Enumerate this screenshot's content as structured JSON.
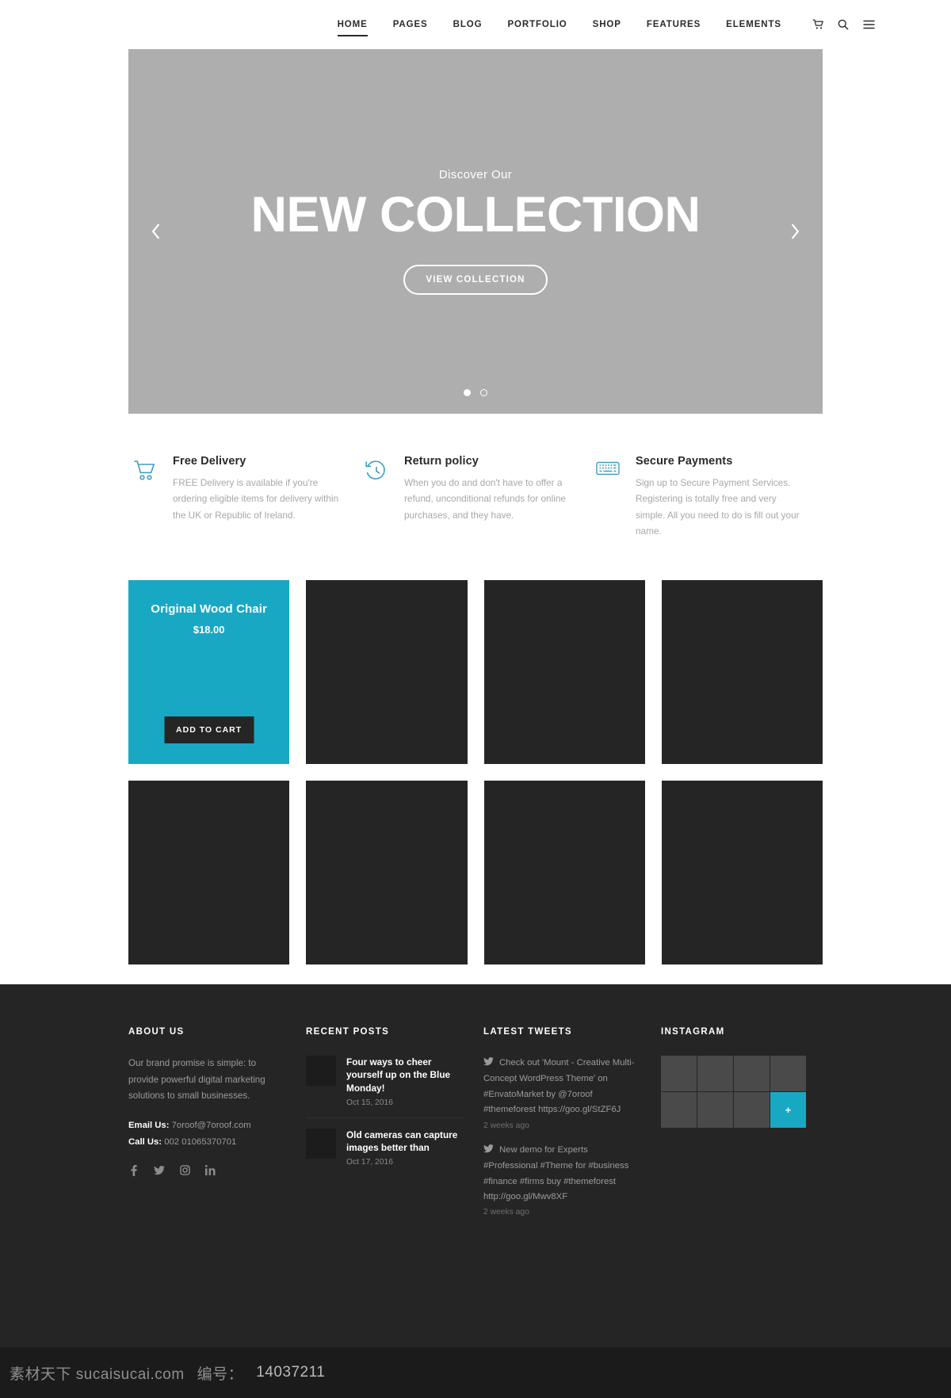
{
  "header": {
    "nav": [
      {
        "label": "HOME",
        "active": true
      },
      {
        "label": "PAGES",
        "active": false
      },
      {
        "label": "BLOG",
        "active": false
      },
      {
        "label": "PORTFOLIO",
        "active": false
      },
      {
        "label": "SHOP",
        "active": false
      },
      {
        "label": "FEATURES",
        "active": false
      },
      {
        "label": "ELEMENTS",
        "active": false
      }
    ],
    "icons": [
      {
        "name": "cart-icon"
      },
      {
        "name": "search-icon"
      },
      {
        "name": "hamburger-menu-icon"
      }
    ]
  },
  "hero": {
    "eyebrow": "Discover Our",
    "title": "NEW COLLECTION",
    "button_label": "VIEW COLLECTION",
    "prev_label": "‹",
    "next_label": "›",
    "slides": 2,
    "active_slide": 1,
    "background_color": "#aeaeae"
  },
  "features": [
    {
      "icon": "shopping-cart-icon",
      "title": "Free Delivery",
      "text": "FREE Delivery is available if you're ordering eligible items for delivery within the UK or Republic of Ireland."
    },
    {
      "icon": "return-clock-icon",
      "title": "Return policy",
      "text": "When you do and don't have to offer a refund, unconditional refunds for online purchases, and they have."
    },
    {
      "icon": "keyboard-icon",
      "title": "Secure Payments",
      "text": "Sign up to Secure Payment Services. Registering is totally free and very simple. All you need to do is fill out your name."
    }
  ],
  "products": {
    "featured": {
      "name": "Original Wood Chair",
      "price": "$18.00",
      "cart_label": "ADD TO CART",
      "accent_color": "#18a8c4"
    },
    "placeholder_count": 7,
    "placeholder_color": "#252525"
  },
  "footer": {
    "about": {
      "title": "ABOUT US",
      "text": "Our brand promise is simple: to provide powerful digital marketing solutions to small businesses.",
      "email_label": "Email Us:",
      "email_value": "7oroof@7oroof.com",
      "call_label": "Call Us:",
      "call_value": "002 01065370701",
      "social": [
        {
          "name": "facebook-icon",
          "glyph": "f"
        },
        {
          "name": "twitter-icon",
          "glyph": "t"
        },
        {
          "name": "instagram-icon",
          "glyph": "i"
        },
        {
          "name": "linkedin-icon",
          "glyph": "in"
        }
      ]
    },
    "recent_posts": {
      "title": "RECENT POSTS",
      "items": [
        {
          "title": "Four ways to cheer yourself up on the Blue Monday!",
          "date": "Oct 15, 2016"
        },
        {
          "title": "Old cameras can capture images better than",
          "date": "Oct 17, 2016"
        }
      ]
    },
    "latest_tweets": {
      "title": "LATEST TWEETS",
      "items": [
        {
          "text": "Check out 'Mount - Creative Multi-Concept WordPress Theme' on #EnvatoMarket by @7oroof #themeforest https://goo.gl/StZF6J",
          "time": "2 weeks ago"
        },
        {
          "text": "New demo for Experts #Professional #Theme for #business #finance #firms buy #themeforest http://goo.gl/Mwv8XF",
          "time": "2 weeks ago"
        }
      ]
    },
    "instagram": {
      "title": "INSTAGRAM",
      "tile_count": 8,
      "accent_tile_index": 7,
      "accent_glyph": "+",
      "accent_color": "#18a8c4"
    }
  },
  "watermark": {
    "site": "素材天下 sucaisucai.com",
    "id_label": "编号：",
    "id_value": "14037211"
  }
}
